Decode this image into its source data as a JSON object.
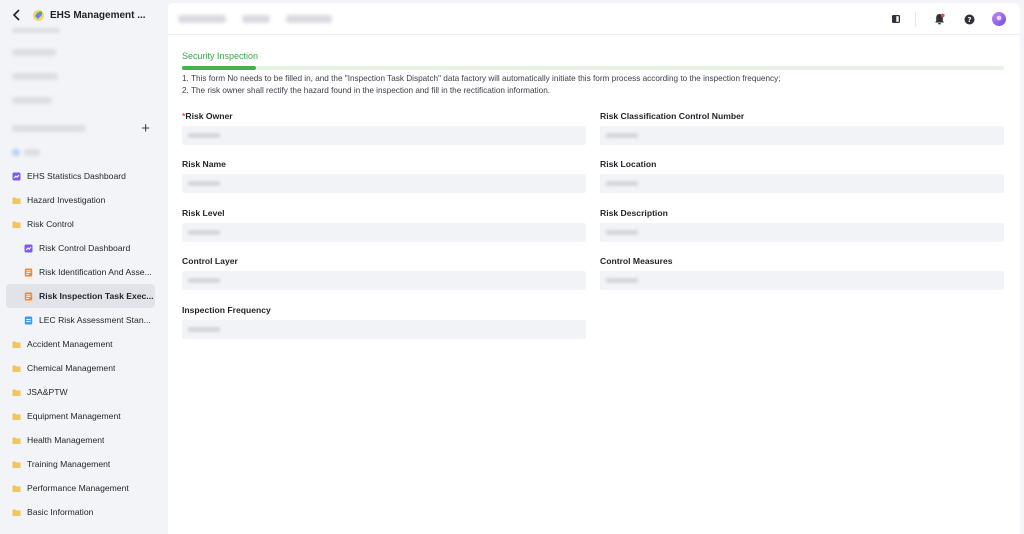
{
  "app": {
    "title": "EHS Management ..."
  },
  "sidebar": {
    "items": [
      {
        "label": "EHS Statistics Dashboard",
        "icon": "dashboard-icon",
        "level": 0
      },
      {
        "label": "Hazard Investigation",
        "icon": "folder-icon",
        "level": 0
      },
      {
        "label": "Risk Control",
        "icon": "folder-icon",
        "level": 0
      },
      {
        "label": "Risk Control Dashboard",
        "icon": "dashboard-icon",
        "level": 1
      },
      {
        "label": "Risk Identification And Asse...",
        "icon": "form-icon",
        "level": 1
      },
      {
        "label": "Risk Inspection Task Exec...",
        "icon": "form-icon",
        "level": 1,
        "active": true
      },
      {
        "label": "LEC Risk Assessment Stan...",
        "icon": "doc-icon",
        "level": 1
      },
      {
        "label": "Accident Management",
        "icon": "folder-icon",
        "level": 0
      },
      {
        "label": "Chemical Management",
        "icon": "folder-icon",
        "level": 0
      },
      {
        "label": "JSA&PTW",
        "icon": "folder-icon",
        "level": 0
      },
      {
        "label": "Equipment Management",
        "icon": "folder-icon",
        "level": 0
      },
      {
        "label": "Health Management",
        "icon": "folder-icon",
        "level": 0
      },
      {
        "label": "Training Management",
        "icon": "folder-icon",
        "level": 0
      },
      {
        "label": "Performance Management",
        "icon": "folder-icon",
        "level": 0
      },
      {
        "label": "Basic Information",
        "icon": "folder-icon",
        "level": 0
      }
    ]
  },
  "form": {
    "tab_label": "Security Inspection",
    "progress": 0.09,
    "notes": [
      "1. This form No needs to be filled in, and the \"Inspection Task Dispatch\" data factory will automatically initiate this form process according to the inspection frequency;",
      "2. The risk owner shall rectify the hazard found in the inspection and fill in the rectification information."
    ],
    "required_mark": "*",
    "fields": {
      "risk_owner": "Risk Owner",
      "risk_classification": "Risk Classification Control Number",
      "risk_name": "Risk Name",
      "risk_location": "Risk Location",
      "risk_level": "Risk Level",
      "risk_description": "Risk Description",
      "control_layer": "Control Layer",
      "control_measures": "Control Measures",
      "inspection_frequency": "Inspection Frequency"
    }
  },
  "colors": {
    "accent_green": "#47b04b",
    "required_red": "#e84a4a",
    "folder_yellow": "#f5c45b",
    "dashboard_purple": "#7b5cf2",
    "form_orange": "#f0883a",
    "doc_blue": "#3b9cf5"
  }
}
